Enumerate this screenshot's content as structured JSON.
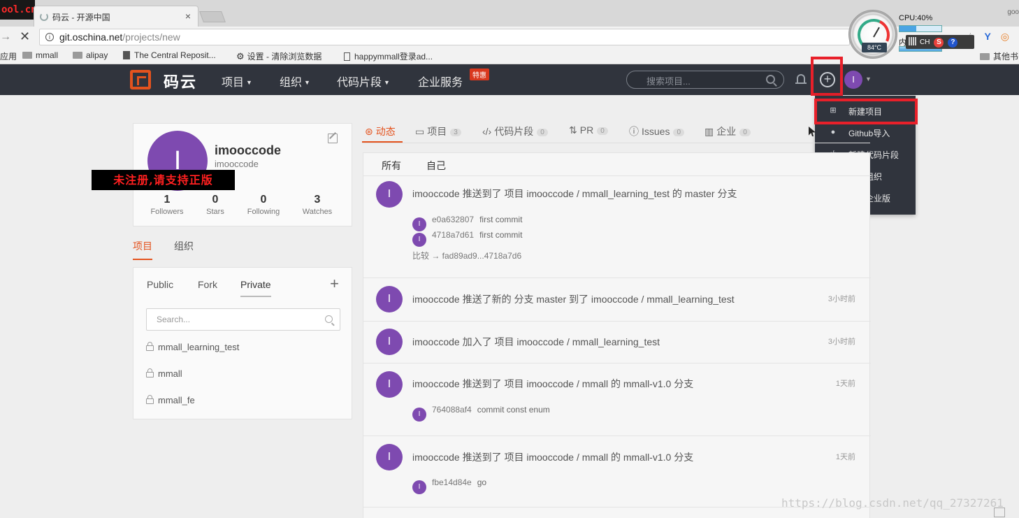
{
  "browser": {
    "watermark_top": "ool.cn",
    "tab_title": "码云 - 开源中国",
    "tab_close": "×",
    "top_right": "goo",
    "url_host": "git.oschina.net",
    "url_path": "/projects/new",
    "nav_back": "→",
    "nav_stop": "✕",
    "ext_icons": [
      "☆",
      "Y",
      "◎"
    ],
    "bookmarks": {
      "apps": "应用",
      "mmall": "mmall",
      "alipay": "alipay",
      "central_repo": "The Central Reposit...",
      "settings": "设置 - 清除浏览数据",
      "happymmall": "happymmall登录ad...",
      "other": "其他书"
    }
  },
  "system_widget": {
    "cpu_label": "CPU:40%",
    "mem_label": "内",
    "temperature": "84°C",
    "ime_label": "CH",
    "ime_s": "S",
    "ime_help": "?",
    "cpu_level_percent": 40
  },
  "site": {
    "logo_text": "码云",
    "nav": {
      "projects": "项目",
      "orgs": "组织",
      "snippets": "代码片段",
      "enterprise": "企业服务",
      "hot_badge": "特惠"
    },
    "search_placeholder": "搜索项目...",
    "avatar_letter": "I"
  },
  "dropdown": {
    "items": [
      {
        "icon": "plus-square-icon",
        "label": "新建项目"
      },
      {
        "icon": "github-icon",
        "label": "Github导入"
      },
      {
        "icon": "code-icon",
        "label": "新建代码片段"
      },
      {
        "icon": "group-icon",
        "label": "创建组织"
      },
      {
        "icon": "building-icon",
        "label": "开通企业版"
      }
    ]
  },
  "profile": {
    "avatar_letter": "I",
    "name": "imooccode",
    "login": "imooccode",
    "unregistered_banner": "未注册,请支持正版",
    "stats": [
      {
        "num": "1",
        "label": "Followers"
      },
      {
        "num": "0",
        "label": "Stars"
      },
      {
        "num": "0",
        "label": "Following"
      },
      {
        "num": "3",
        "label": "Watches"
      }
    ]
  },
  "side_tabs": {
    "projects": "项目",
    "orgs": "组织"
  },
  "projects_card": {
    "filters": {
      "public": "Public",
      "fork": "Fork",
      "private": "Private"
    },
    "add": "+",
    "search_placeholder": "Search...",
    "items": [
      "mmall_learning_test",
      "mmall",
      "mmall_fe"
    ]
  },
  "main_tabs": [
    {
      "icon": "activity-icon",
      "label": "动态",
      "count": ""
    },
    {
      "icon": "folder-icon",
      "label": "项目",
      "count": "3"
    },
    {
      "icon": "code-icon",
      "label": "代码片段",
      "count": "0"
    },
    {
      "icon": "pr-icon",
      "label": "PR",
      "count": "0"
    },
    {
      "icon": "issue-icon",
      "label": "Issues",
      "count": "0"
    },
    {
      "icon": "enterprise-icon",
      "label": "企业",
      "count": "0"
    }
  ],
  "feed": {
    "subtabs": {
      "all": "所有",
      "self": "自己"
    },
    "events": [
      {
        "avatar": "I",
        "text": "imooccode 推送到了 项目 imooccode / mmall_learning_test 的 master 分支",
        "time": "",
        "commits": [
          {
            "sha": "e0a632807",
            "msg": "first commit"
          },
          {
            "sha": "4718a7d61",
            "msg": "first commit"
          }
        ],
        "compare": "比较 → fad89ad9...4718a7d6"
      },
      {
        "avatar": "I",
        "text": "imooccode 推送了新的 分支 master 到了 imooccode / mmall_learning_test",
        "time": "3小时前"
      },
      {
        "avatar": "I",
        "text": "imooccode 加入了 项目 imooccode / mmall_learning_test",
        "time": "3小时前"
      },
      {
        "avatar": "I",
        "text": "imooccode 推送到了 项目 imooccode / mmall 的 mmall-v1.0 分支",
        "time": "1天前",
        "commits": [
          {
            "sha": "764088af4",
            "msg": "commit const enum"
          }
        ]
      },
      {
        "avatar": "I",
        "text": "imooccode 推送到了 项目 imooccode / mmall 的 mmall-v1.0 分支",
        "time": "1天前",
        "commits": [
          {
            "sha": "fbe14d84e",
            "msg": "go"
          }
        ]
      }
    ]
  },
  "watermark_bottom": "https://blog.csdn.net/qq_27327261"
}
